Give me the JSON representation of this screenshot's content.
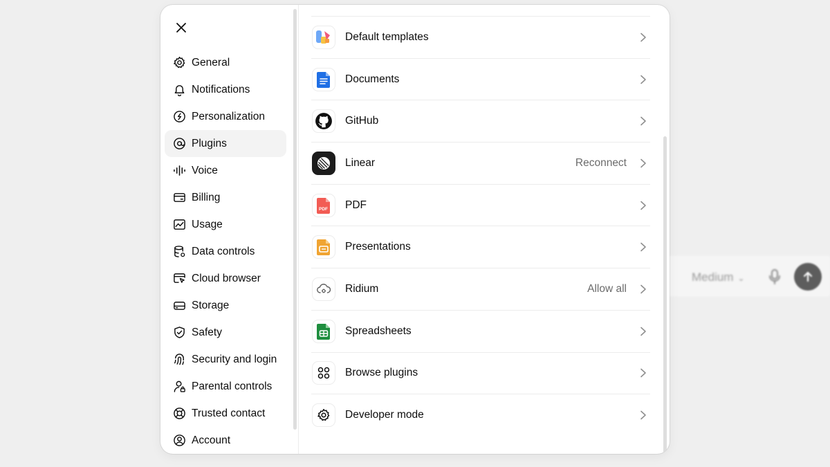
{
  "background": {
    "model_label": "Medium"
  },
  "sidebar": {
    "items": [
      {
        "label": "General",
        "icon": "gear-icon"
      },
      {
        "label": "Notifications",
        "icon": "bell-icon"
      },
      {
        "label": "Personalization",
        "icon": "personalization-icon"
      },
      {
        "label": "Plugins",
        "icon": "plugins-icon",
        "active": true
      },
      {
        "label": "Voice",
        "icon": "voice-waveform-icon"
      },
      {
        "label": "Billing",
        "icon": "credit-card-icon"
      },
      {
        "label": "Usage",
        "icon": "usage-chart-icon"
      },
      {
        "label": "Data controls",
        "icon": "database-icon"
      },
      {
        "label": "Cloud browser",
        "icon": "cloud-browser-icon"
      },
      {
        "label": "Storage",
        "icon": "storage-drive-icon"
      },
      {
        "label": "Safety",
        "icon": "shield-check-icon"
      },
      {
        "label": "Security and login",
        "icon": "fingerprint-icon"
      },
      {
        "label": "Parental controls",
        "icon": "parental-controls-icon"
      },
      {
        "label": "Trusted contact",
        "icon": "lifebuoy-icon"
      },
      {
        "label": "Account",
        "icon": "user-circle-icon"
      }
    ]
  },
  "plugins": [
    {
      "label": "Default templates",
      "status": "",
      "icon": "default-templates-icon"
    },
    {
      "label": "Documents",
      "status": "",
      "icon": "documents-icon"
    },
    {
      "label": "GitHub",
      "status": "",
      "icon": "github-icon"
    },
    {
      "label": "Linear",
      "status": "Reconnect",
      "icon": "linear-icon"
    },
    {
      "label": "PDF",
      "status": "",
      "icon": "pdf-icon",
      "icon_text": "PDF"
    },
    {
      "label": "Presentations",
      "status": "",
      "icon": "presentations-icon"
    },
    {
      "label": "Ridium",
      "status": "Allow all",
      "icon": "ridium-icon"
    },
    {
      "label": "Spreadsheets",
      "status": "",
      "icon": "spreadsheets-icon"
    },
    {
      "label": "Browse plugins",
      "status": "",
      "icon": "browse-plugins-icon"
    },
    {
      "label": "Developer mode",
      "status": "",
      "icon": "developer-mode-icon"
    }
  ],
  "colors": {
    "active_bg": "#f3f3f3",
    "divider": "#ececec",
    "secondary_text": "#6b6b6b"
  }
}
